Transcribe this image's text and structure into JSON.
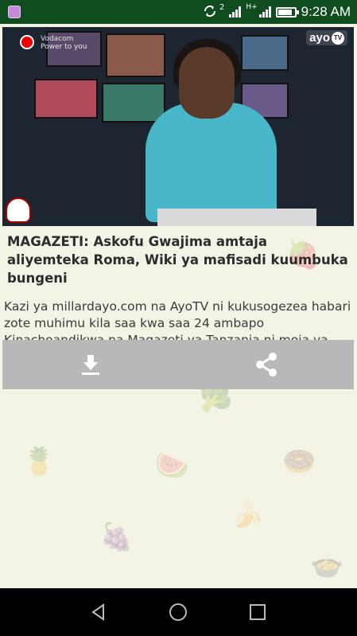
{
  "status_bar": {
    "time": "9:28 AM",
    "sync_superscript": "2",
    "network_type": "H+",
    "battery_level": 0.85,
    "icons": [
      "gallery-icon",
      "sync-icon",
      "signal-icon",
      "signal-icon",
      "battery-icon"
    ]
  },
  "article": {
    "thumbnail": {
      "sponsor_name": "Vodacom",
      "sponsor_tagline": "Power to you",
      "channel_logo": "ayo",
      "channel_logo_suffix": "TV"
    },
    "title": "MAGAZETI: Askofu Gwajima amtaja aliyemteka Roma, Wiki ya mafisadi kuumbuka bungeni",
    "summary": "Kazi ya millardayo.com na AyoTV ni kukusogezea habari zote muhimu kila saa kwa saa 24 ambapo Kinachoandikwa na Magazeti ya Tanzania ni moja ya vitu ..."
  },
  "actions": {
    "download_icon": "download-icon",
    "share_icon": "share-icon"
  },
  "nav_bar": {
    "icons": [
      "back-icon",
      "home-icon",
      "recents-icon"
    ]
  },
  "colors": {
    "status_bar": "#0f4d1e",
    "background": "#f3f3e6",
    "action_bar": "#b8b8b8",
    "nav_bar": "#000000"
  }
}
